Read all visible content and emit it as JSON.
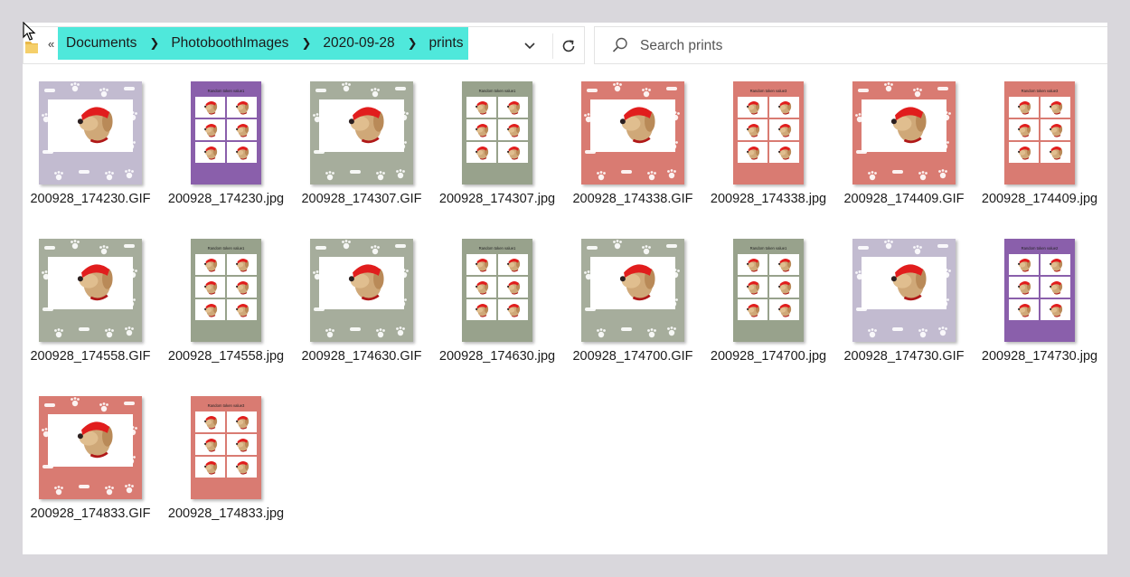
{
  "address_bar": {
    "overflow": "«",
    "crumbs": [
      "Documents",
      "PhotoboothImages",
      "2020-09-28",
      "prints"
    ]
  },
  "search": {
    "placeholder": "Search prints"
  },
  "files": [
    {
      "name": "200928_174230.GIF",
      "kind": "gif",
      "color": "#c2bbd0"
    },
    {
      "name": "200928_174230.jpg",
      "kind": "strip",
      "color": "#8a5fab",
      "caption": "Random token value1"
    },
    {
      "name": "200928_174307.GIF",
      "kind": "gif",
      "color": "#a6ad9c"
    },
    {
      "name": "200928_174307.jpg",
      "kind": "strip",
      "color": "#98a28c",
      "caption": "Random token value1"
    },
    {
      "name": "200928_174338.GIF",
      "kind": "gif",
      "color": "#d97b72"
    },
    {
      "name": "200928_174338.jpg",
      "kind": "strip",
      "color": "#d97b72",
      "caption": "Random token value3"
    },
    {
      "name": "200928_174409.GIF",
      "kind": "gif",
      "color": "#d97b72"
    },
    {
      "name": "200928_174409.jpg",
      "kind": "strip",
      "color": "#d97b72",
      "caption": "Random token value3"
    },
    {
      "name": "200928_174558.GIF",
      "kind": "gif",
      "color": "#a6ad9c"
    },
    {
      "name": "200928_174558.jpg",
      "kind": "strip",
      "color": "#98a28c",
      "caption": "Random token value1"
    },
    {
      "name": "200928_174630.GIF",
      "kind": "gif",
      "color": "#a6ad9c"
    },
    {
      "name": "200928_174630.jpg",
      "kind": "strip",
      "color": "#98a28c",
      "caption": "Random token value1"
    },
    {
      "name": "200928_174700.GIF",
      "kind": "gif",
      "color": "#a6ad9c"
    },
    {
      "name": "200928_174700.jpg",
      "kind": "strip",
      "color": "#98a28c",
      "caption": "Random token value1"
    },
    {
      "name": "200928_174730.GIF",
      "kind": "gif",
      "color": "#c2bbd0"
    },
    {
      "name": "200928_174730.jpg",
      "kind": "strip",
      "color": "#8a5fab",
      "caption": "Random token value2"
    },
    {
      "name": "200928_174833.GIF",
      "kind": "gif",
      "color": "#d97b72"
    },
    {
      "name": "200928_174833.jpg",
      "kind": "strip",
      "color": "#d97b72",
      "caption": "Random token value3"
    }
  ],
  "colors": {
    "breadcrumb_highlight": "#4fe8db",
    "window_bg": "#ffffff",
    "desktop_bg": "#d9d7dc"
  }
}
